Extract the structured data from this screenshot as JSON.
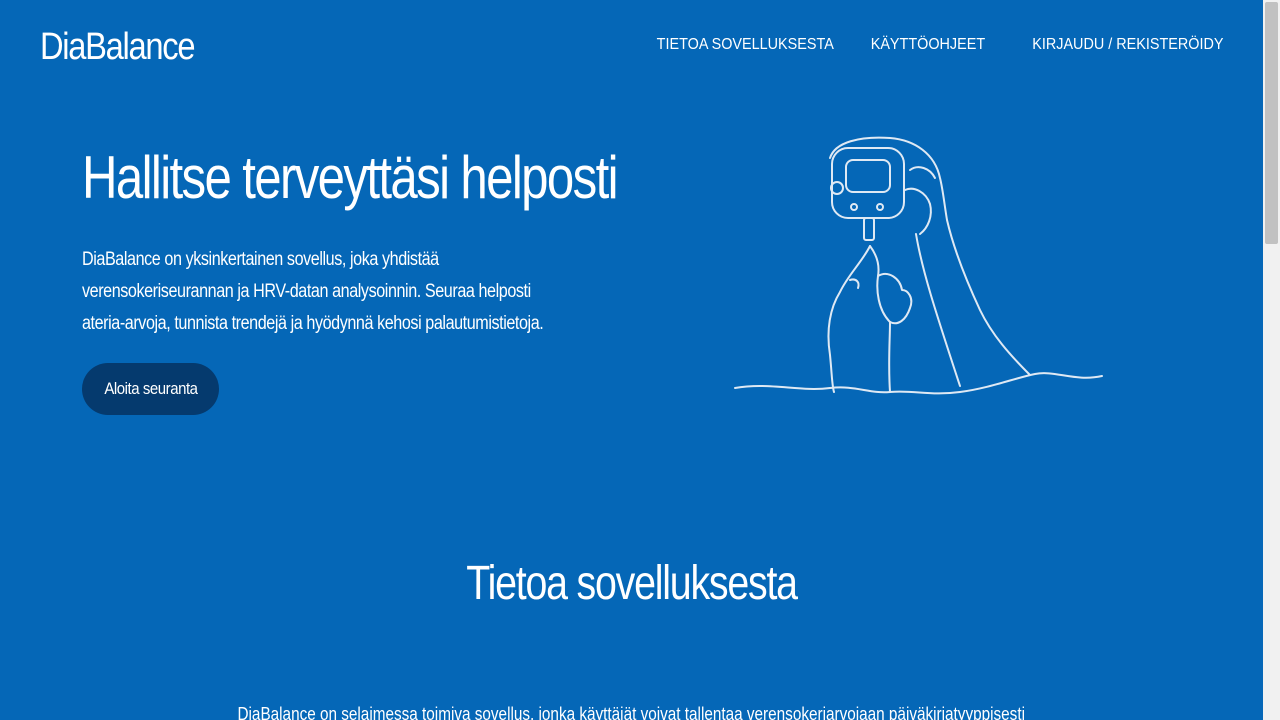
{
  "header": {
    "logo": "DiaBalance",
    "nav": [
      "TIETOA SOVELLUKSESTA",
      "KÄYTTÖOHJEET",
      "KIRJAUDU / REKISTERÖIDY"
    ]
  },
  "hero": {
    "title": "Hallitse terveyttäsi helposti",
    "text": "DiaBalance on yksinkertainen sovellus, joka yhdistää verensokeriseurannan ja HRV-datan analysoinnin. Seuraa helposti ateria-arvoja, tunnista trendejä ja hyödynnä kehosi palautumistietoja.",
    "cta": "Aloita seuranta",
    "illustration_icon": "glucose-meter-hand-illustration"
  },
  "about": {
    "title": "Tietoa sovelluksesta",
    "text": "DiaBalance on selaimessa toimiva sovellus, jonka käyttäjät voivat tallentaa verensokeriarvojaan päiväkirjatyyppisesti"
  },
  "colors": {
    "background": "#0567b7",
    "button": "#053a6e",
    "line_art": "#dfe9f4"
  }
}
